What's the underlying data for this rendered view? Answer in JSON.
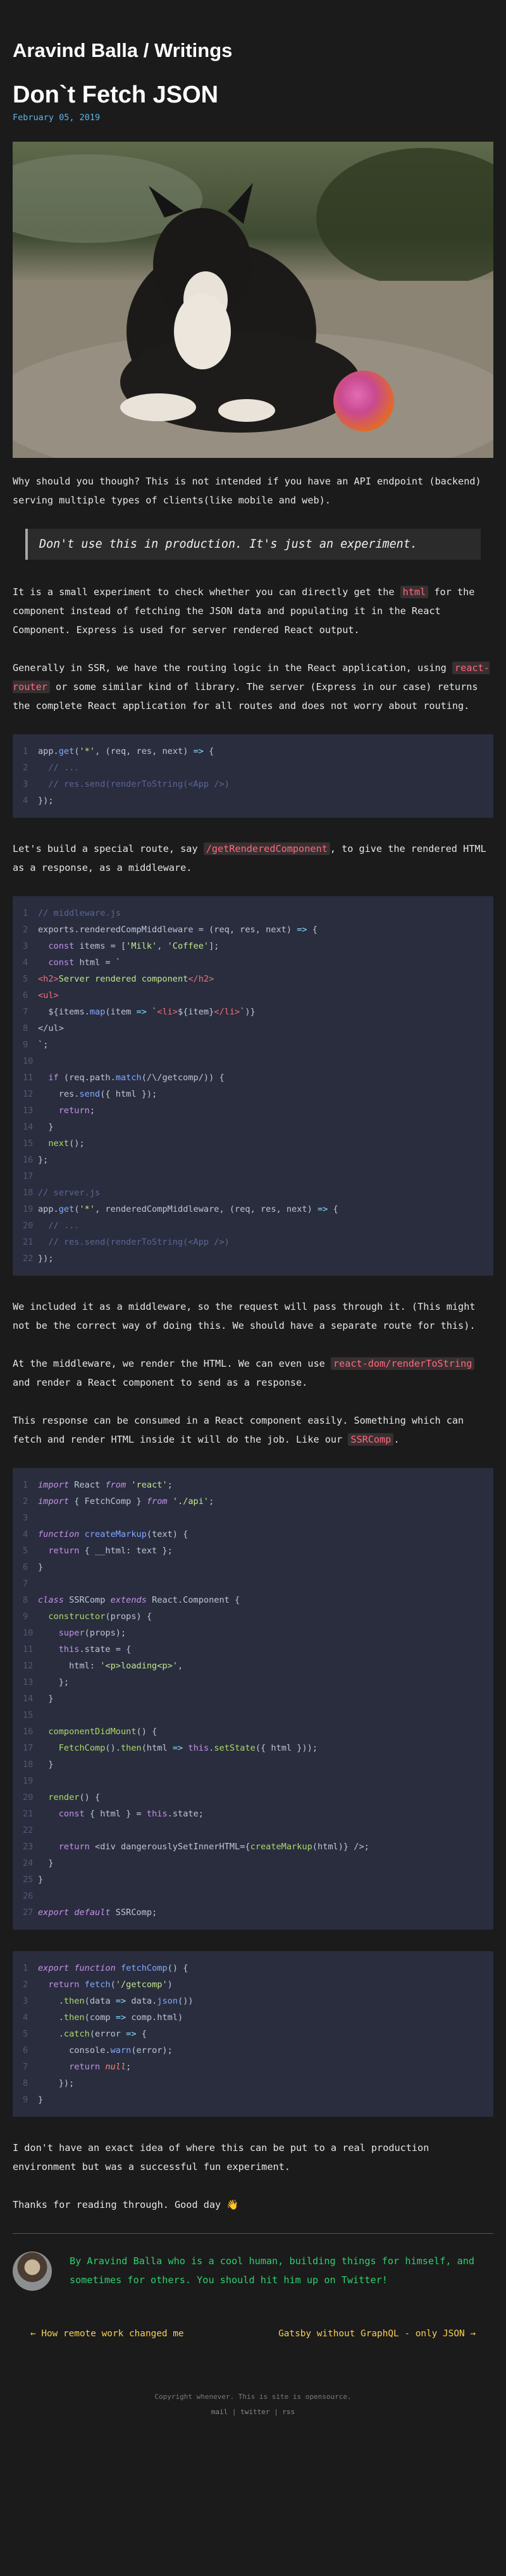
{
  "site_title": "Aravind Balla / Writings",
  "post": {
    "title": "Don`t Fetch JSON",
    "date": "February 05, 2019"
  },
  "p1": "Why should you though? This is not intended if you have an API endpoint (backend) serving multiple types of clients(like mobile and web).",
  "callout": "Don't use this in production. It's just an experiment.",
  "p2": {
    "a": "It is a small experiment to check whether you can directly get the ",
    "code": "html",
    "b": " for the component instead of fetching the JSON data and populating it in the React Component. Express is used for server rendered React output."
  },
  "p3": {
    "a": "Generally in SSR, we have the routing logic in the React application, using ",
    "code": "react-router",
    "b": " or some similar kind of library. The server (Express in our case) returns the complete React application for all routes and does not worry about routing."
  },
  "p4": {
    "a": "Let's build a special route, say ",
    "code": "/getRenderedComponent",
    "b": ", to give the rendered HTML as a response, as a middleware."
  },
  "p5": "We included it as a middleware, so the request will pass through it. (This might not be the correct way of doing this. We should have a separate route for this).",
  "p6": {
    "a": "At the middleware, we render the HTML. We can even use ",
    "code": "react-dom/renderToString",
    "b": " and render a React component to send as a response."
  },
  "p7": {
    "a": "This response can be consumed in a React component easily. Something which can fetch and render HTML inside it will do the job. Like our ",
    "code": "SSRComp",
    "b": "."
  },
  "p8": "I don't have an exact idea of where this can be put to a real production environment but was a successful fun experiment.",
  "p9": "Thanks for reading through. Good day 👋",
  "bio": "By Aravind Balla who is a cool human, building things for himself, and sometimes for others. You should hit him up on Twitter!",
  "nav": {
    "prev": "← How remote work changed me",
    "next": "Gatsby without GraphQL - only JSON →"
  },
  "footer": {
    "copyright": "Copyright whenever. This is site is opensource.",
    "mail": "mail",
    "twitter": "twitter",
    "rss": "rss",
    "sep": " | "
  }
}
